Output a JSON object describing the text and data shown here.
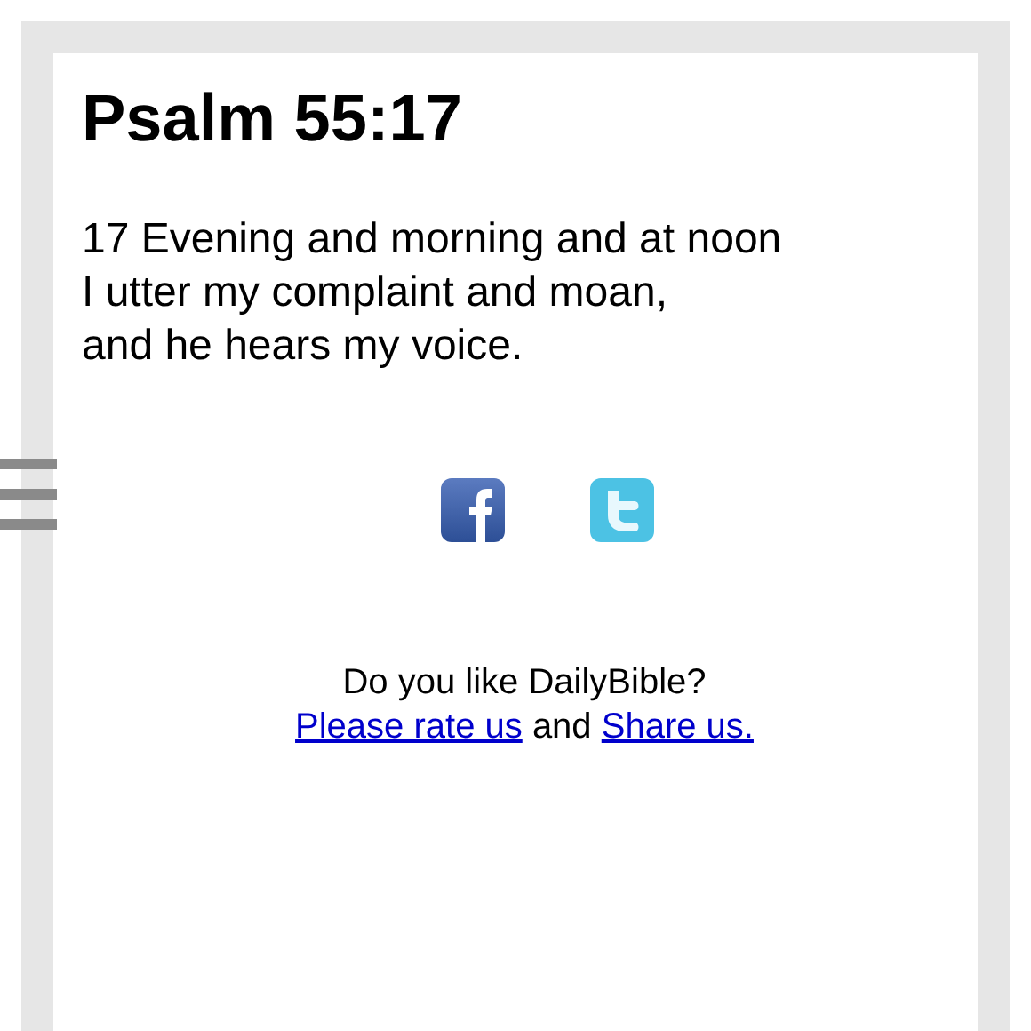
{
  "title": "Psalm 55:17",
  "verse_lines": [
    "17 Evening and morning and at noon",
    "I utter my complaint and moan,",
    "and he hears my voice."
  ],
  "share_icons": [
    {
      "kind": "facebook"
    },
    {
      "kind": "twitter"
    }
  ],
  "prompt": "Do you like DailyBible?",
  "rate_line": {
    "rate_link": "Please rate us",
    "connector": "and",
    "share_link": "Share us."
  }
}
